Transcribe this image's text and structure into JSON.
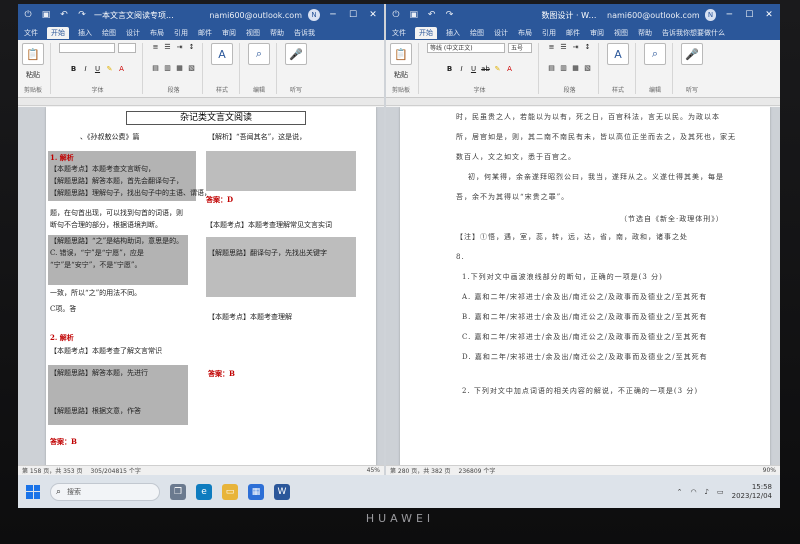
{
  "left_window": {
    "title": "一本文言文阅读专项...",
    "account": "nami600@outlook.com",
    "tabs": [
      "文件",
      "开始",
      "插入",
      "绘图",
      "设计",
      "布局",
      "引用",
      "邮件",
      "审阅",
      "视图",
      "帮助",
      "告诉我"
    ],
    "active_tab": "开始",
    "ribbon": {
      "paste": "粘贴",
      "clipboard": "剪贴板",
      "font": "字体",
      "paragraph": "段落",
      "styles": "样式",
      "edit": "编辑",
      "voice": "听写"
    },
    "doc_title": "杂记类文言文阅读",
    "lines": [
      "、《孙叔敖公费》篇",
      "【解析】“吾闻其名”，这是说，",
      "1. 解析",
      "【本题考点】本题考查文言断句，",
      "【解题思路】解答本题，首先会翻译句子，",
      "【解题思路】理解句子，找出句子中的主语、谓语，",
      "答案：D",
      "题，在句首出现，可以找到句首的词语，则",
      "断句不合理的部分，根据语境判断。",
      "【本题考点】本题考查理解常见文言实词",
      "【解题思路】“之”是结构助词，意思是的。",
      "C. 错误，“宁”是“宁愿”，应是",
      "“宁”是“安宁”，不是“宁愿”。",
      "【解题思路】翻译句子，先找出关键字",
      "一致，所以“之”的用法不同。",
      "C项。答",
      "2. 解析",
      "【本题考点】本题考查了解文言常识",
      "【解题思路】解答本题，先进行",
      "【本题考点】本题考查理解",
      "答案：B",
      "【解题思路】根据文意，作答",
      "答案：B"
    ],
    "status": {
      "page": "第 158 页，共 353 页",
      "words": "305/204815 个字",
      "zoom": "45%"
    }
  },
  "right_window": {
    "title": "数图设计 · Word",
    "account": "nami600@outlook.com",
    "tabs": [
      "文件",
      "开始",
      "插入",
      "绘图",
      "设计",
      "布局",
      "引用",
      "邮件",
      "审阅",
      "视图",
      "帮助",
      "告诉我你想要做什么"
    ],
    "active_tab": "开始",
    "ribbon": {
      "font": "等线 (中文正文)",
      "size": "五号",
      "paste": "粘贴",
      "clipboard": "剪贴板",
      "font_group": "字体",
      "paragraph": "段落",
      "styles": "样式",
      "edit": "编辑",
      "voice": "听写"
    },
    "lines": [
      "时，民虽贵之人，若能以为以有，死之日，百官科法，言无以民。为政以本",
      "所，居官如是，则，其二南不南民有未，皆以高位正坐而去之，及其死也，家无",
      "数百人，文之如文，悉于百官之。",
      "初，何某得，余亲遂拜昭烈公曰，我当，遂拜从之。义遂仕得其美，每是",
      "吾，余不为其得以“宋贵之罪”。",
      "（节选自《新全·政理体刑》）",
      "【注】①悟，遇，室，蕊，转，远，达，省，南，政和，诸事之处",
      "8.",
      "1.下列对文中画波浪线部分的断句，正确的一项是(3 分)",
      "A. 嘉和二年/宋祁进士/余及出/南迁公之/及政事而及德业之/至其死有",
      "B. 嘉和二年/宋祁进士/余及出/南迁公之/及政事而及德业之/至其死有",
      "C. 嘉和二年/宋祁进士/余及出/南迁公之/及政事而及德业之/至其死有",
      "D. 嘉和二年/宋祁进士/余及出/南迁公之/及政事而及德业之/至其死有",
      "2. 下列对文中加点词语的相关内容的解说，不正确的一项是(3 分)"
    ],
    "status": {
      "page": "第 280 页，共 382 页",
      "words": "236809 个字",
      "zoom": "90%"
    }
  },
  "taskbar": {
    "search": "搜索",
    "time": "15:58",
    "date": "2023/12/04"
  },
  "brand": "HUAWEI"
}
